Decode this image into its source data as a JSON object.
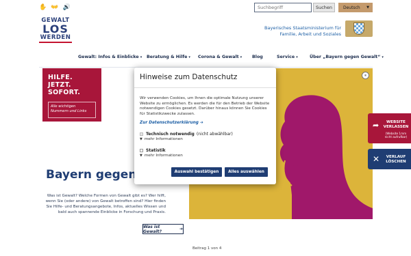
{
  "topbar": {
    "icons": [
      "hands-icon",
      "sign-language-icon",
      "speaker-icon"
    ],
    "search_placeholder": "Suchbegriff",
    "search_button": "Suchen",
    "language": "Deutsch"
  },
  "header": {
    "logo_line1": "GEWALT",
    "logo_line2": "LOS",
    "logo_line3": "WERDEN",
    "ministry_line1": "Bayerisches Staatsministerium für",
    "ministry_line2": "Familie, Arbeit und Soziales"
  },
  "nav": {
    "items": [
      {
        "label": "Gewalt: Infos & Einblicke",
        "has_submenu": true
      },
      {
        "label": "Beratung & Hilfe",
        "has_submenu": true
      },
      {
        "label": "Corona & Gewalt",
        "has_submenu": true
      },
      {
        "label": "Blog",
        "has_submenu": false
      },
      {
        "label": "Service",
        "has_submenu": true
      },
      {
        "label": "Über „Bayern gegen Gewalt“",
        "has_submenu": true
      }
    ]
  },
  "promo": {
    "heading_line1": "HILFE. JETZT.",
    "heading_line2": "SOFORT.",
    "link_text": "Alle wichtigen Nummern und Links"
  },
  "hero": {
    "title": "Bayern gegen",
    "text": "Was ist Gewalt? Welche Formen von Gewalt gibt es? Wer hilft, wenn Sie (oder andere) von Gewalt betroffen sind? Hier finden Sie Hilfe- und Beratungsangebote, Infos, aktuelles Wissen und bald auch spannende Einblicke in Forschung und Praxis.",
    "link_label": "Was ist Gewalt?",
    "slide_status": "Beitrag 1 von 4"
  },
  "side": {
    "exit_label_line1": "WEBSITE",
    "exit_label_line2": "VERLASSEN",
    "exit_sub": "(Website 1mm nicht aufrufbar)",
    "clear_label_line1": "VERLAUF",
    "clear_label_line2": "LÖSCHEN"
  },
  "modal": {
    "title": "Hinweise zum Datenschutz",
    "body": "Wir verwenden Cookies, um Ihnen die optimale Nutzung unserer Website zu ermöglichen. Es werden die für den Betrieb der Website notwendigen Cookies gesetzt. Darüber hinaus können Sie Cookies für Statistikzwecke zulassen.",
    "privacy_link": "Zur Datenschutzerklärung",
    "opt1_label": "Technisch notwendig",
    "opt1_note": "(nicht abwählbar)",
    "opt2_label": "Statistik",
    "more_info": "mehr Informationen",
    "confirm_button": "Auswahl bestätigen",
    "select_all_button": "Alles auswählen"
  },
  "colors": {
    "navy": "#1f3d73",
    "crimson": "#a8163a",
    "hero_yellow": "#dcb43a",
    "hero_magenta": "#a0186a",
    "link_blue": "#1d5fa5"
  }
}
